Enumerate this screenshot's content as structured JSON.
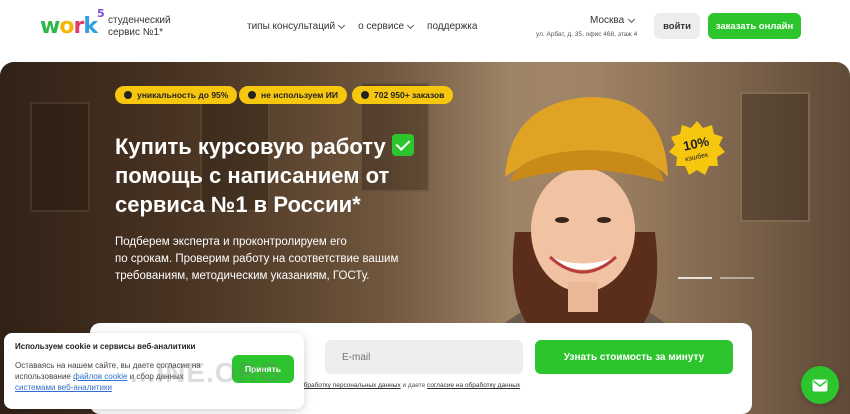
{
  "header": {
    "logo": {
      "w": "w",
      "o": "o",
      "r": "r",
      "k": "k",
      "sup": "5"
    },
    "tagline_line1": "студенческий",
    "tagline_line2": "сервис №1*",
    "nav": [
      {
        "label": "типы консультаций",
        "has_dropdown": true
      },
      {
        "label": "о сервисе",
        "has_dropdown": true
      },
      {
        "label": "поддержка",
        "has_dropdown": false
      }
    ],
    "city": "Москва",
    "address": "ул. Арбат, д. 35, офис 468, этаж 4",
    "login_label": "войти",
    "order_label": "заказать онлайн"
  },
  "hero": {
    "badges": [
      {
        "icon": "shield-icon",
        "label": "уникальность до 95%"
      },
      {
        "icon": "no-ai-icon",
        "label": "не используем ИИ"
      },
      {
        "icon": "fire-icon",
        "label": "702 950+ заказов"
      }
    ],
    "headline_line1": "Купить курсовую работу",
    "headline_line2": "помощь с написанием от",
    "headline_line3": "сервиса №1 в России*",
    "subtext_line1": "Подберем эксперта и проконтролируем его",
    "subtext_line2": "по срокам. Проверим работу на соответствие вашим",
    "subtext_line3": "требованиям, методическим указаниям, ГОСТу.",
    "cashback_value": "10%",
    "cashback_label": "кэшбек"
  },
  "form": {
    "email_placeholder": "E-mail",
    "submit_label": "Узнать стоимость за минуту",
    "agree_prefix": "...",
    "agree_link1": "обработку персональных данных",
    "agree_mid": "и даете",
    "agree_link2": "согласие на обработку данных"
  },
  "cookie": {
    "title": "Используем cookie и сервисы веб-аналитики",
    "body_text1": "Оставаясь на нашем сайте, вы даете согласие на использование",
    "body_link1": "файлов cookie",
    "body_text2": "и сбор данных",
    "body_link2": "системами веб-аналитики",
    "accept_label": "Принять"
  },
  "watermark": "...INE.ORG",
  "colors": {
    "accent_green": "#2dc52d",
    "badge_yellow": "#f7c710"
  }
}
